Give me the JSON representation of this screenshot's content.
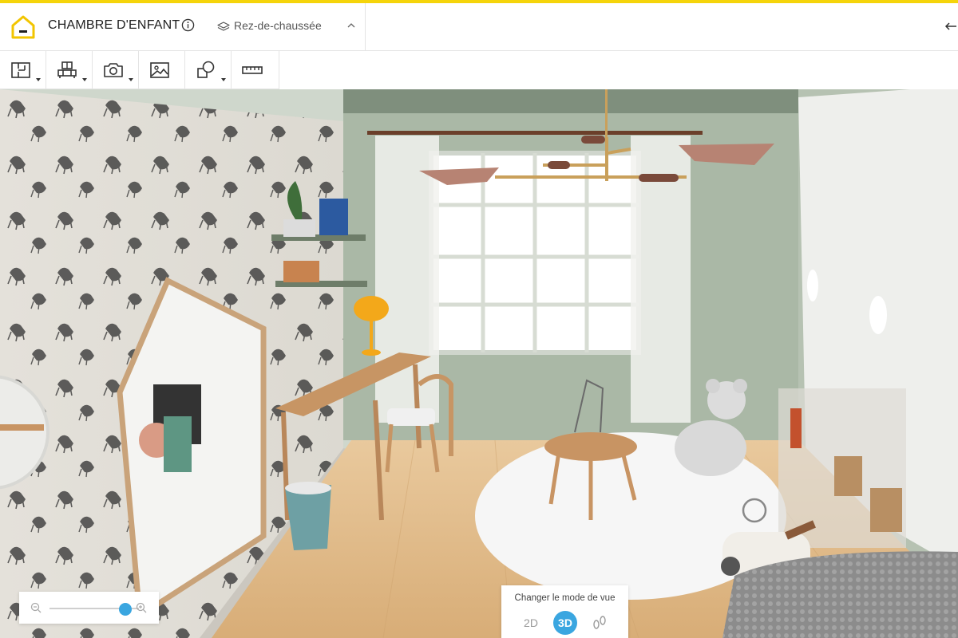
{
  "header": {
    "project_title": "CHAMBRE D'ENFANT",
    "level_label": "Rez-de-chaussée"
  },
  "icons": {
    "logo": "house-logo",
    "info": "info-icon",
    "level": "layers-icon",
    "level_chevron": "chevron-up-icon",
    "back": "arrow-left-icon",
    "zoom_out": "zoom-out-icon",
    "zoom_in": "zoom-in-icon",
    "walk": "footsteps-icon"
  },
  "toolbar": {
    "tools": [
      {
        "name": "floor-plan-tool",
        "icon": "floor-plan-icon",
        "has_dropdown": true
      },
      {
        "name": "furniture-tool",
        "icon": "furniture-icon",
        "has_dropdown": true
      },
      {
        "name": "camera-tool",
        "icon": "camera-icon",
        "has_dropdown": true
      },
      {
        "name": "image-tool",
        "icon": "image-icon",
        "has_dropdown": false
      },
      {
        "name": "shapes-tool",
        "icon": "shapes-icon",
        "has_dropdown": true
      },
      {
        "name": "measure-tool",
        "icon": "ruler-icon",
        "has_dropdown": false
      }
    ]
  },
  "zoom": {
    "level_fraction": 0.85
  },
  "view_mode": {
    "label": "Changer le mode de vue",
    "option_2d": "2D",
    "option_3d": "3D",
    "active": "3D"
  },
  "colors": {
    "accent_yellow": "#f5d40a",
    "active_blue": "#3aa6e0"
  }
}
